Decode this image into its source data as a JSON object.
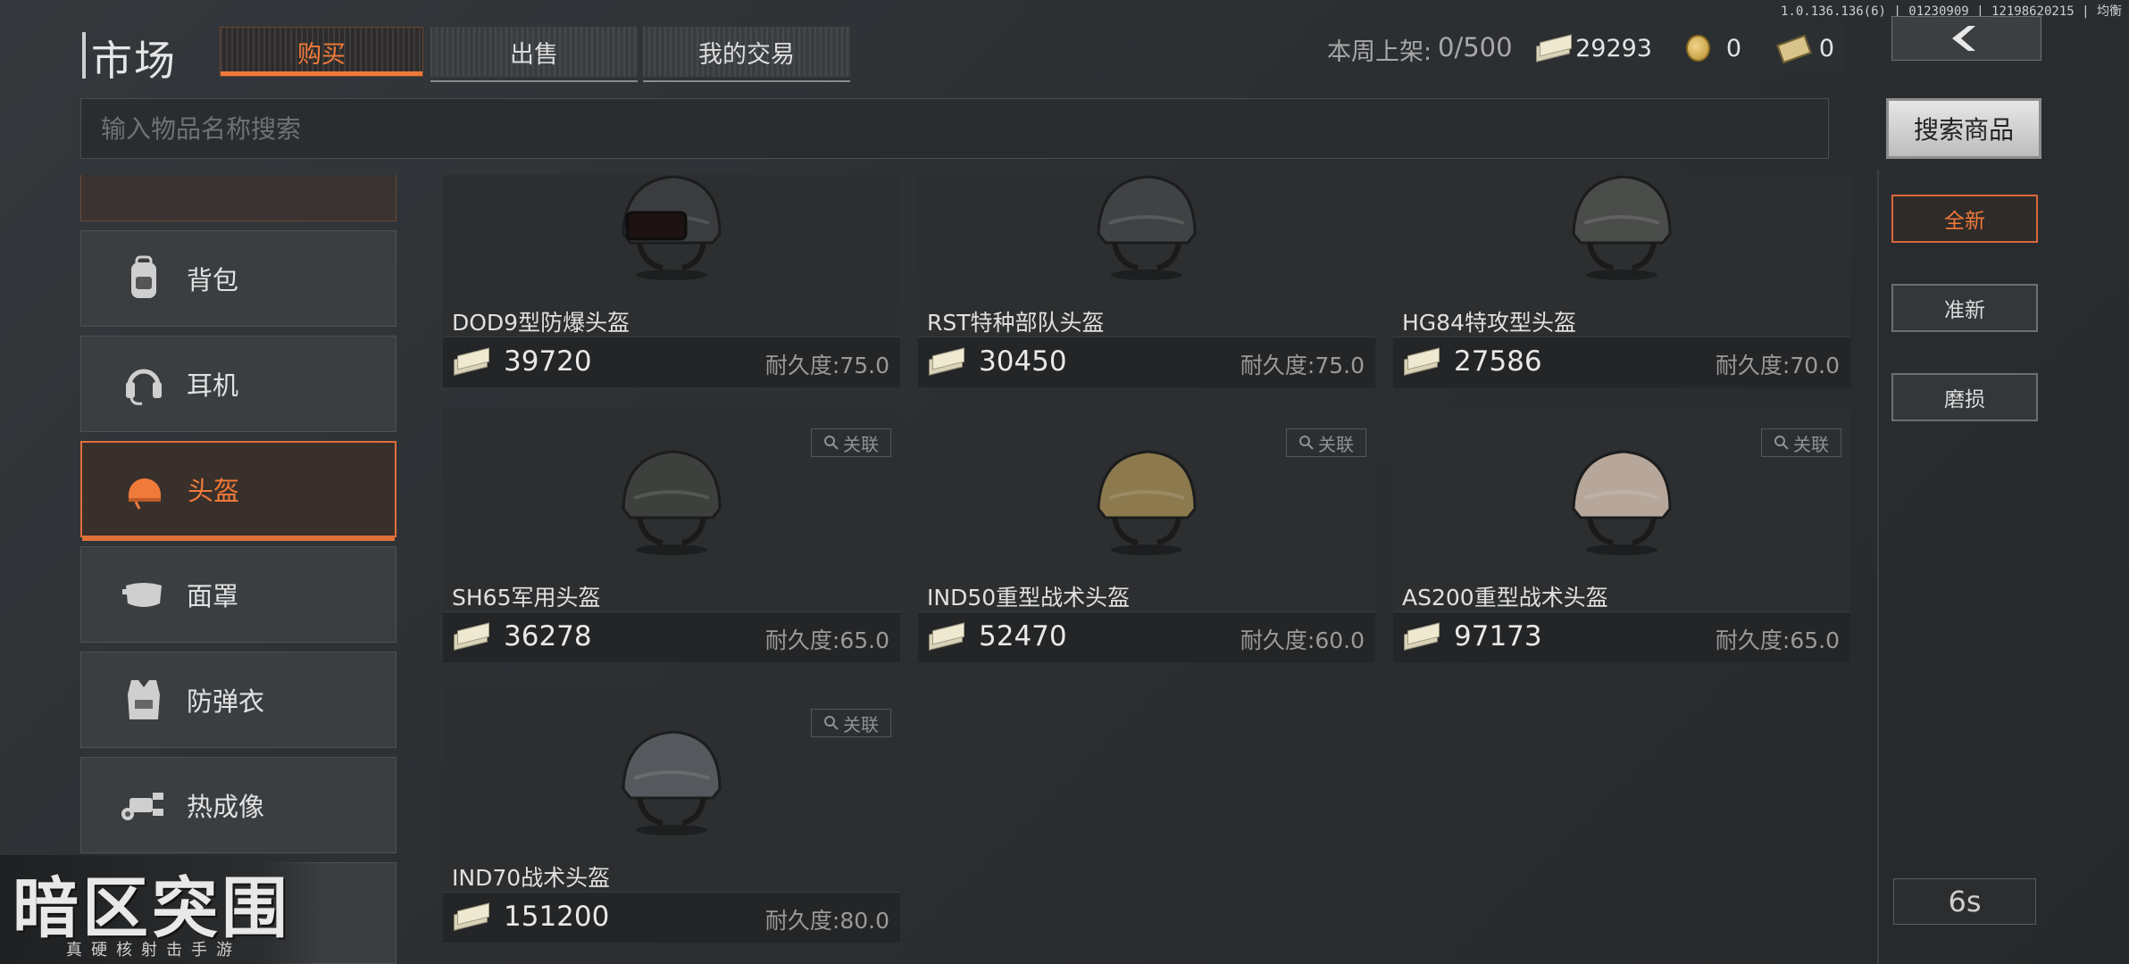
{
  "version_text": "1.0.136.136(6) | 01230909 | 12198620215 | 均衡",
  "header": {
    "title": "市场",
    "tabs": [
      {
        "label": "购买",
        "active": true
      },
      {
        "label": "出售"
      },
      {
        "label": "我的交易"
      }
    ],
    "weekly_label": "本周上架:",
    "weekly_value": "0/500",
    "cash": "29293",
    "coins": "0",
    "tickets": "0"
  },
  "search": {
    "placeholder": "输入物品名称搜索",
    "button": "搜索商品"
  },
  "sidebar": {
    "items": [
      {
        "label": "背包",
        "icon": "backpack-icon"
      },
      {
        "label": "耳机",
        "icon": "headset-icon"
      },
      {
        "label": "头盔",
        "icon": "helmet-icon",
        "active": true
      },
      {
        "label": "面罩",
        "icon": "mask-icon"
      },
      {
        "label": "防弹衣",
        "icon": "vest-icon"
      },
      {
        "label": "热成像",
        "icon": "thermal-icon"
      }
    ]
  },
  "items": [
    {
      "name": "DOD9型防爆头盔",
      "price": "39720",
      "durability": "耐久度:75.0",
      "helmet_color": "#3a3c3e",
      "visor": true
    },
    {
      "name": "RST特种部队头盔",
      "price": "30450",
      "durability": "耐久度:75.0",
      "helmet_color": "#404244"
    },
    {
      "name": "HG84特攻型头盔",
      "price": "27586",
      "durability": "耐久度:70.0",
      "helmet_color": "#4a4c4a"
    },
    {
      "name": "SH65军用头盔",
      "price": "36278",
      "durability": "耐久度:65.0",
      "helmet_color": "#3e403e",
      "related": "关联"
    },
    {
      "name": "IND50重型战术头盔",
      "price": "52470",
      "durability": "耐久度:60.0",
      "helmet_color": "#8c7a4e",
      "related": "关联"
    },
    {
      "name": "AS200重型战术头盔",
      "price": "97173",
      "durability": "耐久度:65.0",
      "helmet_color": "#b7a79a",
      "related": "关联"
    },
    {
      "name": "IND70战术头盔",
      "price": "151200",
      "durability": "耐久度:80.0",
      "helmet_color": "#55585c",
      "related": "关联"
    }
  ],
  "filters": [
    {
      "label": "全新",
      "active": true
    },
    {
      "label": "准新"
    },
    {
      "label": "磨损"
    }
  ],
  "timer": "6s",
  "logo": {
    "main": "暗区突围",
    "sub": "真硬核射击手游"
  }
}
